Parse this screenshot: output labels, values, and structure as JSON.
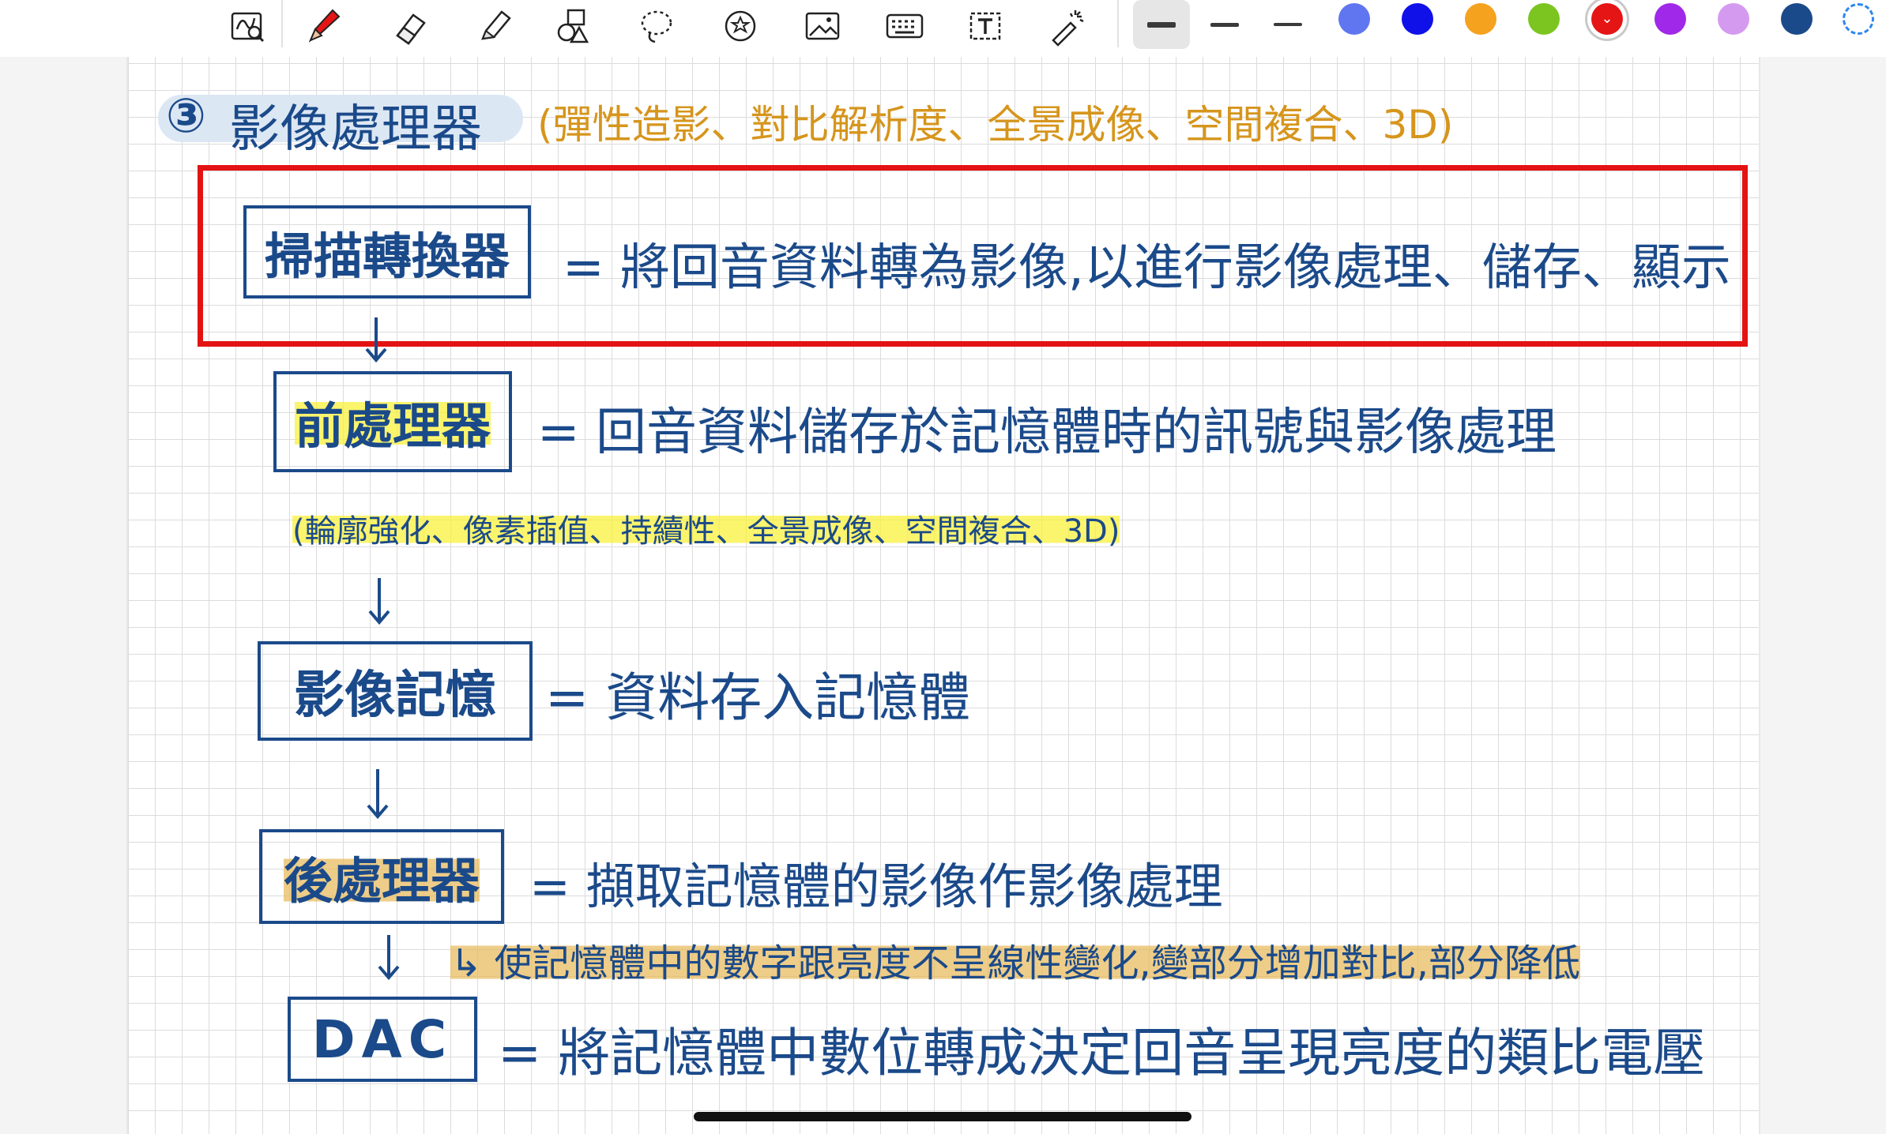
{
  "toolbar": {
    "tools": [
      {
        "name": "lasso-zoom-icon"
      },
      {
        "name": "pen-icon"
      },
      {
        "name": "eraser-icon"
      },
      {
        "name": "highlighter-icon"
      },
      {
        "name": "shapes-icon"
      },
      {
        "name": "lasso-icon"
      },
      {
        "name": "sticker-icon"
      },
      {
        "name": "image-icon"
      },
      {
        "name": "keyboard-icon"
      },
      {
        "name": "text-icon"
      },
      {
        "name": "laser-pointer-icon"
      }
    ],
    "thickness_selected": 0,
    "colors": [
      "#6076f0",
      "#1010e8",
      "#f5a21f",
      "#7cc520",
      "#e61515",
      "#a028e8",
      "#d49af0",
      "#1b4a8a"
    ],
    "selected_color": "#e61515"
  },
  "note": {
    "heading_number": "③",
    "heading_title": "影像處理器",
    "heading_subtitle": "(彈性造影、對比解析度、全景成像、空間複合、3D)",
    "rows": [
      {
        "label": "掃描轉換器",
        "text": "= 將回音資料轉為影像,以進行影像處理、儲存、顯示"
      },
      {
        "label": "前處理器",
        "text": "= 回音資料儲存於記憶體時的訊號與影像處理"
      },
      {
        "label": "影像記憶",
        "text": "= 資料存入記憶體"
      },
      {
        "label": "後處理器",
        "text": "= 擷取記憶體的影像作影像處理"
      },
      {
        "label": "DAC",
        "text": "= 將記憶體中數位轉成決定回音呈現亮度的類比電壓"
      }
    ],
    "preprocessor_note": "(輪廓強化、像素插值、持續性、全景成像、空間複合、3D)",
    "postprocessor_note": "↳ 使記憶體中的數字跟亮度不呈線性變化,變部分增加對比,部分降低"
  }
}
